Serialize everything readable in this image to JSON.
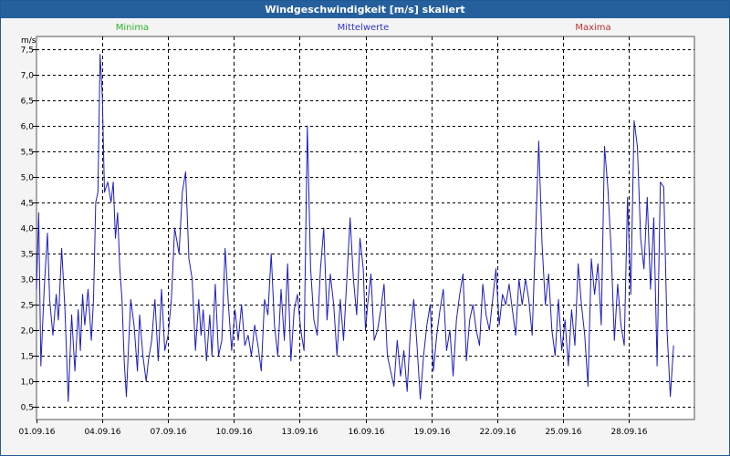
{
  "window": {
    "title": "Windgeschwindigkeit [m/s] skaliert"
  },
  "colors": {
    "titlebar": "#25609d",
    "series": "#1c1cc0",
    "minima": "#2db42d",
    "mittelwerte": "#3030d0",
    "maxima": "#c03030"
  },
  "chart_data": {
    "type": "line",
    "title": "Windgeschwindigkeit [m/s] skaliert",
    "ylabel": "m/s",
    "xlabel": "",
    "ylim": [
      0.25,
      7.75
    ],
    "y_ticks": [
      "0,5",
      "1,0",
      "1,5",
      "2,0",
      "2,5",
      "3,0",
      "3,5",
      "4,0",
      "4,5",
      "5,0",
      "5,5",
      "6,0",
      "6,5",
      "7,0",
      "7,5"
    ],
    "x_tick_labels": [
      "01.09.16",
      "04.09.16",
      "07.09.16",
      "10.09.16",
      "13.09.16",
      "16.09.16",
      "19.09.16",
      "22.09.16",
      "25.09.16",
      "28.09.16"
    ],
    "x_tick_days": [
      1,
      4,
      7,
      10,
      13,
      16,
      19,
      22,
      25,
      28
    ],
    "xlim_days": [
      1,
      31
    ],
    "grid": true,
    "legend": [
      "Minima",
      "Mittelwerte",
      "Maxima"
    ],
    "series": [
      {
        "name": "Mittelwerte",
        "x_days": [
          1.0,
          1.1,
          1.2,
          1.35,
          1.5,
          1.6,
          1.75,
          1.9,
          2.0,
          2.15,
          2.3,
          2.45,
          2.6,
          2.75,
          2.9,
          3.0,
          3.1,
          3.2,
          3.35,
          3.5,
          3.6,
          3.7,
          3.8,
          3.9,
          4.0,
          4.1,
          4.25,
          4.4,
          4.5,
          4.6,
          4.7,
          4.8,
          4.9,
          5.0,
          5.1,
          5.2,
          5.3,
          5.45,
          5.6,
          5.7,
          5.85,
          6.0,
          6.1,
          6.25,
          6.4,
          6.55,
          6.7,
          6.85,
          7.0,
          7.15,
          7.3,
          7.5,
          7.65,
          7.8,
          7.95,
          8.1,
          8.25,
          8.4,
          8.5,
          8.6,
          8.75,
          8.9,
          9.0,
          9.15,
          9.3,
          9.45,
          9.6,
          9.75,
          9.9,
          10.05,
          10.2,
          10.35,
          10.5,
          10.65,
          10.8,
          10.95,
          11.1,
          11.25,
          11.4,
          11.55,
          11.7,
          11.85,
          12.0,
          12.15,
          12.3,
          12.45,
          12.6,
          12.75,
          12.9,
          13.05,
          13.2,
          13.35,
          13.5,
          13.65,
          13.8,
          13.95,
          14.1,
          14.25,
          14.4,
          14.55,
          14.7,
          14.85,
          15.0,
          15.15,
          15.3,
          15.45,
          15.6,
          15.75,
          15.9,
          16.0,
          16.1,
          16.25,
          16.4,
          16.55,
          16.7,
          16.85,
          17.0,
          17.15,
          17.3,
          17.45,
          17.6,
          17.75,
          17.9,
          18.05,
          18.2,
          18.35,
          18.5,
          18.65,
          18.8,
          18.95,
          19.1,
          19.25,
          19.4,
          19.55,
          19.7,
          19.85,
          20.0,
          20.15,
          20.3,
          20.45,
          20.6,
          20.75,
          20.9,
          21.05,
          21.2,
          21.35,
          21.5,
          21.65,
          21.8,
          21.95,
          22.1,
          22.25,
          22.4,
          22.55,
          22.7,
          22.85,
          23.0,
          23.15,
          23.3,
          23.45,
          23.6,
          23.75,
          23.9,
          24.05,
          24.2,
          24.35,
          24.5,
          24.65,
          24.8,
          24.95,
          25.1,
          25.25,
          25.4,
          25.55,
          25.7,
          25.85,
          26.0,
          26.15,
          26.3,
          26.45,
          26.6,
          26.75,
          26.9,
          27.05,
          27.2,
          27.35,
          27.5,
          27.65,
          27.8,
          27.95,
          28.1,
          28.25,
          28.4,
          28.55,
          28.7,
          28.85,
          29.0,
          29.15,
          29.3,
          29.45,
          29.6,
          29.75,
          29.9,
          30.05,
          30.2,
          30.35,
          30.5,
          30.65,
          30.8,
          30.95
        ],
        "values": [
          2.8,
          4.3,
          1.3,
          2.8,
          3.9,
          2.6,
          1.9,
          2.7,
          2.2,
          3.6,
          2.4,
          0.6,
          2.3,
          1.2,
          2.4,
          1.6,
          2.7,
          2.1,
          2.8,
          1.8,
          2.6,
          4.5,
          4.7,
          7.4,
          6.6,
          4.7,
          4.9,
          4.5,
          4.9,
          3.8,
          4.3,
          3.2,
          2.6,
          1.4,
          0.7,
          1.7,
          2.6,
          2.1,
          1.2,
          2.3,
          1.5,
          1.0,
          1.4,
          1.8,
          2.6,
          1.4,
          2.8,
          1.6,
          1.9,
          2.6,
          4.0,
          3.5,
          4.7,
          5.1,
          3.4,
          3.0,
          1.6,
          2.6,
          1.9,
          2.4,
          1.4,
          2.3,
          1.5,
          2.9,
          1.5,
          1.8,
          3.6,
          2.5,
          1.6,
          2.4,
          1.8,
          2.5,
          1.7,
          1.9,
          1.5,
          2.1,
          1.7,
          1.2,
          2.6,
          2.3,
          3.5,
          2.1,
          1.5,
          2.8,
          1.8,
          3.3,
          1.4,
          2.4,
          2.7,
          2.0,
          1.6,
          6.0,
          3.2,
          2.2,
          1.9,
          3.2,
          4.0,
          2.2,
          3.1,
          2.5,
          1.5,
          2.6,
          1.8,
          3.0,
          4.2,
          3.0,
          2.3,
          3.8,
          3.2,
          2.0,
          2.5,
          3.1,
          1.8,
          2.0,
          2.4,
          2.9,
          1.5,
          1.2,
          0.9,
          1.8,
          1.1,
          1.6,
          0.8,
          2.0,
          2.6,
          1.7,
          0.65,
          1.5,
          2.1,
          2.5,
          1.2,
          1.9,
          2.4,
          2.8,
          1.6,
          2.0,
          1.1,
          2.2,
          2.7,
          3.1,
          1.4,
          2.2,
          2.5,
          2.0,
          1.7,
          2.9,
          2.3,
          2.0,
          2.6,
          3.2,
          2.1,
          2.7,
          2.5,
          2.9,
          2.4,
          1.9,
          3.0,
          2.5,
          3.0,
          2.6,
          1.9,
          3.8,
          5.7,
          3.7,
          2.5,
          3.1,
          2.0,
          1.5,
          2.6,
          1.6,
          2.2,
          1.3,
          2.4,
          1.7,
          3.3,
          2.5,
          1.9,
          0.9,
          3.4,
          2.7,
          3.3,
          2.1,
          5.6,
          4.8,
          3.6,
          1.8,
          2.9,
          2.1,
          1.7,
          4.6,
          2.7,
          6.1,
          5.6,
          3.8,
          3.2,
          4.6,
          2.8,
          4.2,
          1.3,
          4.9,
          4.8,
          2.0,
          0.7,
          1.7
        ]
      }
    ]
  }
}
